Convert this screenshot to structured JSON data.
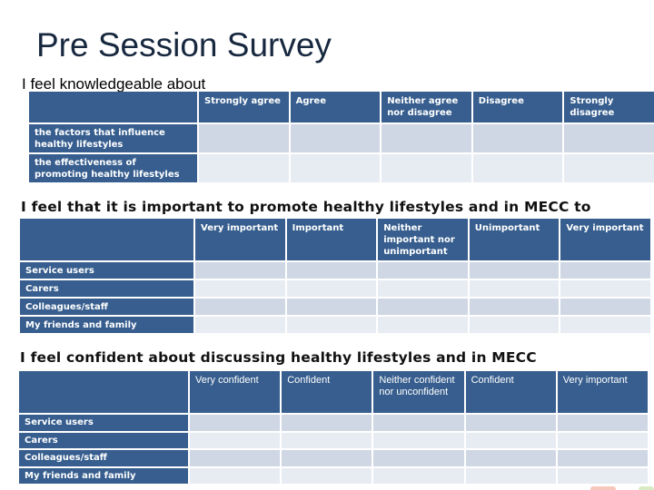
{
  "slide": {
    "title": "Pre Session Survey"
  },
  "colors": {
    "header_bg": "#375e8e",
    "cell_odd": "#cfd6e4",
    "cell_even": "#e7ebf2",
    "title_text": "#17283f"
  },
  "questions": [
    {
      "heading": "I feel knowledgeable about",
      "columns": [
        "Strongly agree",
        "Agree",
        "Neither agree nor disagree",
        "Disagree",
        "Strongly disagree"
      ],
      "rows": [
        "the factors that influence healthy lifestyles",
        "the effectiveness of promoting healthy lifestyles"
      ]
    },
    {
      "heading": "I feel that it is important to promote healthy lifestyles and in MECC to",
      "columns": [
        "Very important",
        "Important",
        "Neither important nor unimportant",
        "Unimportant",
        "Very important"
      ],
      "rows": [
        "Service users",
        "Carers",
        "Colleagues/staff",
        "My friends and family"
      ]
    },
    {
      "heading": "I feel confident about discussing healthy lifestyles and in MECC",
      "columns": [
        "Very confident",
        "Confident",
        "Neither confident nor unconfident",
        "Confident",
        "Very important"
      ],
      "rows": [
        "Service users",
        "Carers",
        "Colleagues/staff",
        "My friends and family"
      ]
    }
  ]
}
